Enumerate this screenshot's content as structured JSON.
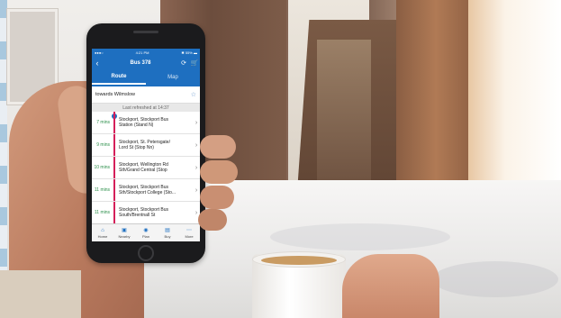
{
  "app": {
    "status": {
      "carrier": "●●●○",
      "time": "4:21 PM",
      "battery": "✱ 55% ▬"
    },
    "title": "Bus 378",
    "icons": {
      "back": "chevron-left-icon",
      "refresh": "refresh-icon",
      "cart": "cart-icon"
    },
    "tabs": [
      {
        "label": "Route",
        "active": true
      },
      {
        "label": "Map",
        "active": false
      }
    ],
    "direction": "towards Wilmslow",
    "last_refreshed": "Last refreshed at 14:37",
    "stops": [
      {
        "time": "7 mins",
        "name_line1": "Stockport, Stockport Bus",
        "name_line2": "Station (Stand N)"
      },
      {
        "time": "9 mins",
        "name_line1": "Stockport, St. Petersgate/",
        "name_line2": "Lord St (Stop Nn)"
      },
      {
        "time": "10 mins",
        "name_line1": "Stockport, Wellington Rd",
        "name_line2": "Sth/Grand Central (Stop"
      },
      {
        "time": "11 mins",
        "name_line1": "Stockport, Stockport Bus",
        "name_line2": "Sth/Stockport College (Sto..."
      },
      {
        "time": "11 mins",
        "name_line1": "Stockport, Stockport Bus",
        "name_line2": "South/Brentnall St"
      }
    ],
    "bottom_tabs": [
      {
        "label": "Home",
        "icon": "home-icon"
      },
      {
        "label": "Nearby",
        "icon": "bus-icon"
      },
      {
        "label": "Plan",
        "icon": "pin-icon"
      },
      {
        "label": "Buy",
        "icon": "ticket-icon"
      },
      {
        "label": "More",
        "icon": "more-icon"
      }
    ],
    "colors": {
      "primary": "#1e6fc0",
      "route_line": "#d51f5a",
      "eta": "#2c8f4a"
    }
  }
}
